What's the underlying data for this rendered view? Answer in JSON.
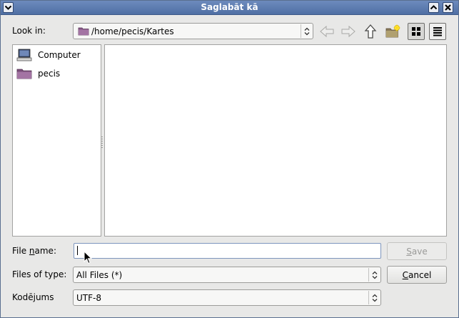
{
  "window": {
    "title": "Saglabāt kā"
  },
  "titlebar": {
    "menu_icon": "chevron-down-icon",
    "maximize_icon": "chevron-up-icon",
    "close_icon": "close-icon"
  },
  "look_in": {
    "label_pre": "",
    "label_u": "",
    "label": "Look in:",
    "path": "/home/pecis/Kartes",
    "folder_icon": "folder-icon"
  },
  "toolbar": {
    "back_icon": "arrow-left-icon",
    "forward_icon": "arrow-right-icon",
    "up_icon": "arrow-up-icon",
    "new_folder_icon": "new-folder-icon",
    "detail_view_icon": "grid-view-icon",
    "list_view_icon": "list-view-icon"
  },
  "places": [
    {
      "label": "Computer",
      "icon": "computer-icon"
    },
    {
      "label": "pecis",
      "icon": "folder-icon"
    }
  ],
  "file_name": {
    "label_pre": "File ",
    "label_u": "n",
    "label_post": "ame:",
    "value": ""
  },
  "files_of_type": {
    "label": "Files of type:",
    "value": "All Files (*)"
  },
  "encoding": {
    "label": "Kodējums",
    "value": "UTF-8"
  },
  "buttons": {
    "save_u": "S",
    "save_rest": "ave",
    "cancel_u": "C",
    "cancel_rest": "ancel"
  },
  "colors": {
    "titlebar": "#5a78ab",
    "accent": "#7d95bd",
    "folder": "#8a5a8a"
  }
}
